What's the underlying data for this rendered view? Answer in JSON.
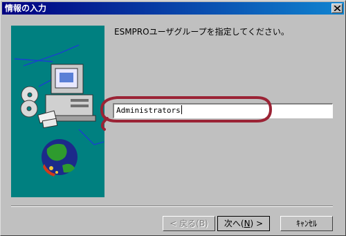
{
  "window": {
    "title": "情報の入力"
  },
  "dialog": {
    "prompt": "ESMPROユーザグループを指定してください。",
    "group_field": {
      "value": "Administrators"
    }
  },
  "buttons": {
    "back_label": "< 戻る(B)",
    "next_label_prefix": "次へ(",
    "next_hotkey": "N",
    "next_label_suffix": ") >",
    "cancel_label": "ｷｬﾝｾﾙ"
  },
  "colors": {
    "titlebar": "#000080",
    "art_background": "#008080",
    "annotation_ring": "#9b2335"
  }
}
